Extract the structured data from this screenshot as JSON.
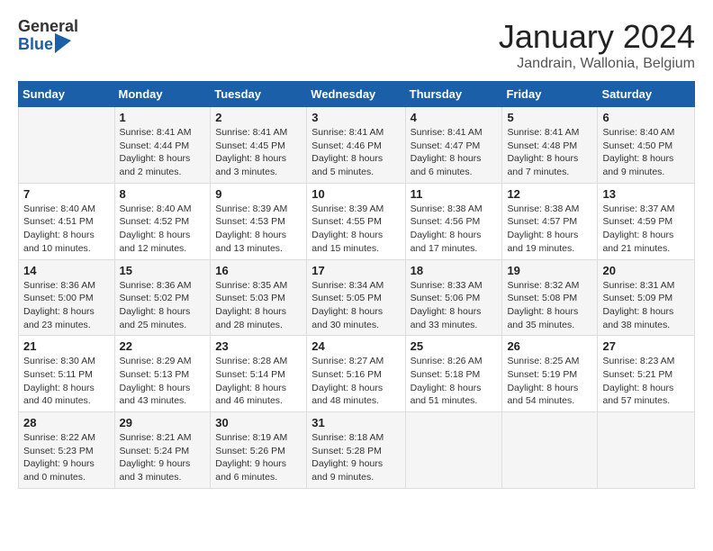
{
  "header": {
    "logo_general": "General",
    "logo_blue": "Blue",
    "month_title": "January 2024",
    "location": "Jandrain, Wallonia, Belgium"
  },
  "weekdays": [
    "Sunday",
    "Monday",
    "Tuesday",
    "Wednesday",
    "Thursday",
    "Friday",
    "Saturday"
  ],
  "weeks": [
    [
      {
        "day": "",
        "info": ""
      },
      {
        "day": "1",
        "info": "Sunrise: 8:41 AM\nSunset: 4:44 PM\nDaylight: 8 hours\nand 2 minutes."
      },
      {
        "day": "2",
        "info": "Sunrise: 8:41 AM\nSunset: 4:45 PM\nDaylight: 8 hours\nand 3 minutes."
      },
      {
        "day": "3",
        "info": "Sunrise: 8:41 AM\nSunset: 4:46 PM\nDaylight: 8 hours\nand 5 minutes."
      },
      {
        "day": "4",
        "info": "Sunrise: 8:41 AM\nSunset: 4:47 PM\nDaylight: 8 hours\nand 6 minutes."
      },
      {
        "day": "5",
        "info": "Sunrise: 8:41 AM\nSunset: 4:48 PM\nDaylight: 8 hours\nand 7 minutes."
      },
      {
        "day": "6",
        "info": "Sunrise: 8:40 AM\nSunset: 4:50 PM\nDaylight: 8 hours\nand 9 minutes."
      }
    ],
    [
      {
        "day": "7",
        "info": "Sunrise: 8:40 AM\nSunset: 4:51 PM\nDaylight: 8 hours\nand 10 minutes."
      },
      {
        "day": "8",
        "info": "Sunrise: 8:40 AM\nSunset: 4:52 PM\nDaylight: 8 hours\nand 12 minutes."
      },
      {
        "day": "9",
        "info": "Sunrise: 8:39 AM\nSunset: 4:53 PM\nDaylight: 8 hours\nand 13 minutes."
      },
      {
        "day": "10",
        "info": "Sunrise: 8:39 AM\nSunset: 4:55 PM\nDaylight: 8 hours\nand 15 minutes."
      },
      {
        "day": "11",
        "info": "Sunrise: 8:38 AM\nSunset: 4:56 PM\nDaylight: 8 hours\nand 17 minutes."
      },
      {
        "day": "12",
        "info": "Sunrise: 8:38 AM\nSunset: 4:57 PM\nDaylight: 8 hours\nand 19 minutes."
      },
      {
        "day": "13",
        "info": "Sunrise: 8:37 AM\nSunset: 4:59 PM\nDaylight: 8 hours\nand 21 minutes."
      }
    ],
    [
      {
        "day": "14",
        "info": "Sunrise: 8:36 AM\nSunset: 5:00 PM\nDaylight: 8 hours\nand 23 minutes."
      },
      {
        "day": "15",
        "info": "Sunrise: 8:36 AM\nSunset: 5:02 PM\nDaylight: 8 hours\nand 25 minutes."
      },
      {
        "day": "16",
        "info": "Sunrise: 8:35 AM\nSunset: 5:03 PM\nDaylight: 8 hours\nand 28 minutes."
      },
      {
        "day": "17",
        "info": "Sunrise: 8:34 AM\nSunset: 5:05 PM\nDaylight: 8 hours\nand 30 minutes."
      },
      {
        "day": "18",
        "info": "Sunrise: 8:33 AM\nSunset: 5:06 PM\nDaylight: 8 hours\nand 33 minutes."
      },
      {
        "day": "19",
        "info": "Sunrise: 8:32 AM\nSunset: 5:08 PM\nDaylight: 8 hours\nand 35 minutes."
      },
      {
        "day": "20",
        "info": "Sunrise: 8:31 AM\nSunset: 5:09 PM\nDaylight: 8 hours\nand 38 minutes."
      }
    ],
    [
      {
        "day": "21",
        "info": "Sunrise: 8:30 AM\nSunset: 5:11 PM\nDaylight: 8 hours\nand 40 minutes."
      },
      {
        "day": "22",
        "info": "Sunrise: 8:29 AM\nSunset: 5:13 PM\nDaylight: 8 hours\nand 43 minutes."
      },
      {
        "day": "23",
        "info": "Sunrise: 8:28 AM\nSunset: 5:14 PM\nDaylight: 8 hours\nand 46 minutes."
      },
      {
        "day": "24",
        "info": "Sunrise: 8:27 AM\nSunset: 5:16 PM\nDaylight: 8 hours\nand 48 minutes."
      },
      {
        "day": "25",
        "info": "Sunrise: 8:26 AM\nSunset: 5:18 PM\nDaylight: 8 hours\nand 51 minutes."
      },
      {
        "day": "26",
        "info": "Sunrise: 8:25 AM\nSunset: 5:19 PM\nDaylight: 8 hours\nand 54 minutes."
      },
      {
        "day": "27",
        "info": "Sunrise: 8:23 AM\nSunset: 5:21 PM\nDaylight: 8 hours\nand 57 minutes."
      }
    ],
    [
      {
        "day": "28",
        "info": "Sunrise: 8:22 AM\nSunset: 5:23 PM\nDaylight: 9 hours\nand 0 minutes."
      },
      {
        "day": "29",
        "info": "Sunrise: 8:21 AM\nSunset: 5:24 PM\nDaylight: 9 hours\nand 3 minutes."
      },
      {
        "day": "30",
        "info": "Sunrise: 8:19 AM\nSunset: 5:26 PM\nDaylight: 9 hours\nand 6 minutes."
      },
      {
        "day": "31",
        "info": "Sunrise: 8:18 AM\nSunset: 5:28 PM\nDaylight: 9 hours\nand 9 minutes."
      },
      {
        "day": "",
        "info": ""
      },
      {
        "day": "",
        "info": ""
      },
      {
        "day": "",
        "info": ""
      }
    ]
  ]
}
